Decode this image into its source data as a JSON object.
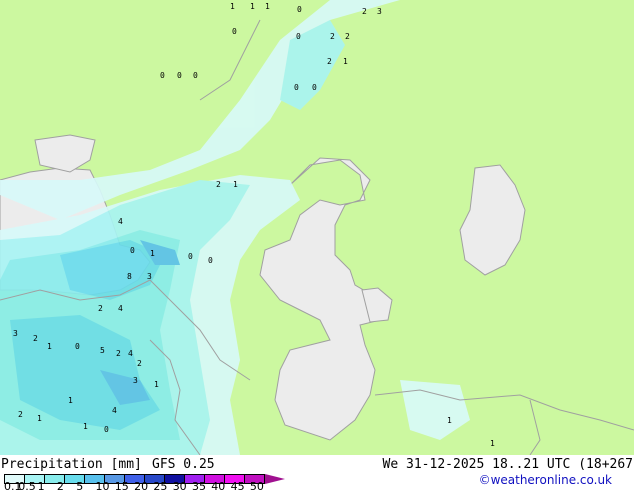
{
  "title": "Precipitation [mm]",
  "model": "GFS 0.25",
  "valid_time": "We 31-12-2025 18..21 UTC (18+267",
  "credit": "©weatheronline.co.uk",
  "colors": {
    "land": "#ccf8a0",
    "sea": "#ececec",
    "border": "#a0a0a0"
  },
  "legend": {
    "ticks": [
      "0.1",
      "0.5",
      "1",
      "2",
      "5",
      "10",
      "15",
      "20",
      "25",
      "30",
      "35",
      "40",
      "45",
      "50"
    ],
    "swatches": [
      "#e0fafa",
      "#a8f4f4",
      "#88ecec",
      "#68dcec",
      "#58c0ec",
      "#5898e4",
      "#4060e8",
      "#2848c8",
      "#1010a0",
      "#a020f0",
      "#d010e0",
      "#f010f0",
      "#c010c0"
    ],
    "arrow_color": "#a01090"
  },
  "map_values": [
    "1",
    "1",
    "1",
    "0",
    "2",
    "3",
    "0",
    "0",
    "2",
    "2",
    "0",
    "0",
    "0",
    "2",
    "1",
    "0",
    "0",
    "2",
    "1",
    "4",
    "1",
    "0",
    "0",
    "0",
    "8",
    "3",
    "2",
    "4",
    "3",
    "2",
    "1",
    "0",
    "5",
    "2",
    "4",
    "3",
    "1",
    "2",
    "1",
    "4",
    "2",
    "1",
    "1",
    "0",
    "1",
    "1"
  ]
}
